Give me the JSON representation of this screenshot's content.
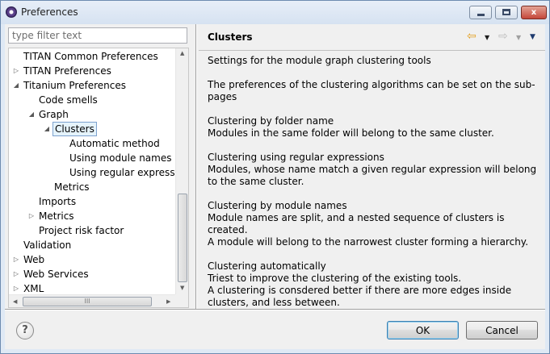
{
  "window": {
    "title": "Preferences",
    "minimize_glyph": "",
    "close_glyph": "x"
  },
  "sidebar": {
    "filter_placeholder": "type filter text",
    "tree": [
      {
        "label": "TITAN Common Preferences",
        "expander": "",
        "level": 0
      },
      {
        "label": "TITAN Preferences",
        "expander": "▷",
        "level": 0
      },
      {
        "label": "Titanium Preferences",
        "expander": "◢",
        "level": 0
      },
      {
        "label": "Code smells",
        "expander": "",
        "level": 1
      },
      {
        "label": "Graph",
        "expander": "◢",
        "level": 1
      },
      {
        "label": "Clusters",
        "expander": "◢",
        "level": 2,
        "selected": true
      },
      {
        "label": "Automatic method",
        "expander": "",
        "level": 3
      },
      {
        "label": "Using module names",
        "expander": "",
        "level": 3
      },
      {
        "label": "Using regular expression",
        "expander": "",
        "level": 3
      },
      {
        "label": "Metrics",
        "expander": "",
        "level": 2
      },
      {
        "label": "Imports",
        "expander": "",
        "level": 1
      },
      {
        "label": "Metrics",
        "expander": "▷",
        "level": 1
      },
      {
        "label": "Project risk factor",
        "expander": "",
        "level": 1
      },
      {
        "label": "Validation",
        "expander": "",
        "level": 0
      },
      {
        "label": "Web",
        "expander": "▷",
        "level": 0
      },
      {
        "label": "Web Services",
        "expander": "▷",
        "level": 0
      },
      {
        "label": "XML",
        "expander": "▷",
        "level": 0
      }
    ],
    "hscroll_grip": "III"
  },
  "page": {
    "title": "Clusters",
    "nav": {
      "back_icon": "back-arrow-icon",
      "forward_icon": "forward-arrow-icon",
      "back_glyph": "⇦",
      "forward_glyph": "⇨",
      "dropdown_glyph": "▼"
    },
    "paragraphs": [
      [
        "Settings for the module graph clustering tools"
      ],
      [
        "The preferences of the clustering algorithms can be set on the sub-pages"
      ],
      [
        "Clustering by folder name",
        "Modules in the same folder will belong to the same cluster."
      ],
      [
        "Clustering using regular expressions",
        "Modules, whose name match a given regular expression will belong to the same cluster."
      ],
      [
        "Clustering by module names",
        "Module names are split, and a nested sequence of clusters is created.",
        "A module will belong to the narrowest cluster forming a hierarchy."
      ],
      [
        "Clustering automatically",
        "Triest to improve the clustering of the existing tools.",
        "A clustering is consdered better if there are more edges inside clusters, and less between."
      ]
    ]
  },
  "footer": {
    "help_glyph": "?",
    "ok_label": "OK",
    "cancel_label": "Cancel"
  },
  "colors": {
    "selection_bg": "#e5f3fb",
    "selection_border": "#7da2ce",
    "back_arrow": "#e39f1e"
  }
}
